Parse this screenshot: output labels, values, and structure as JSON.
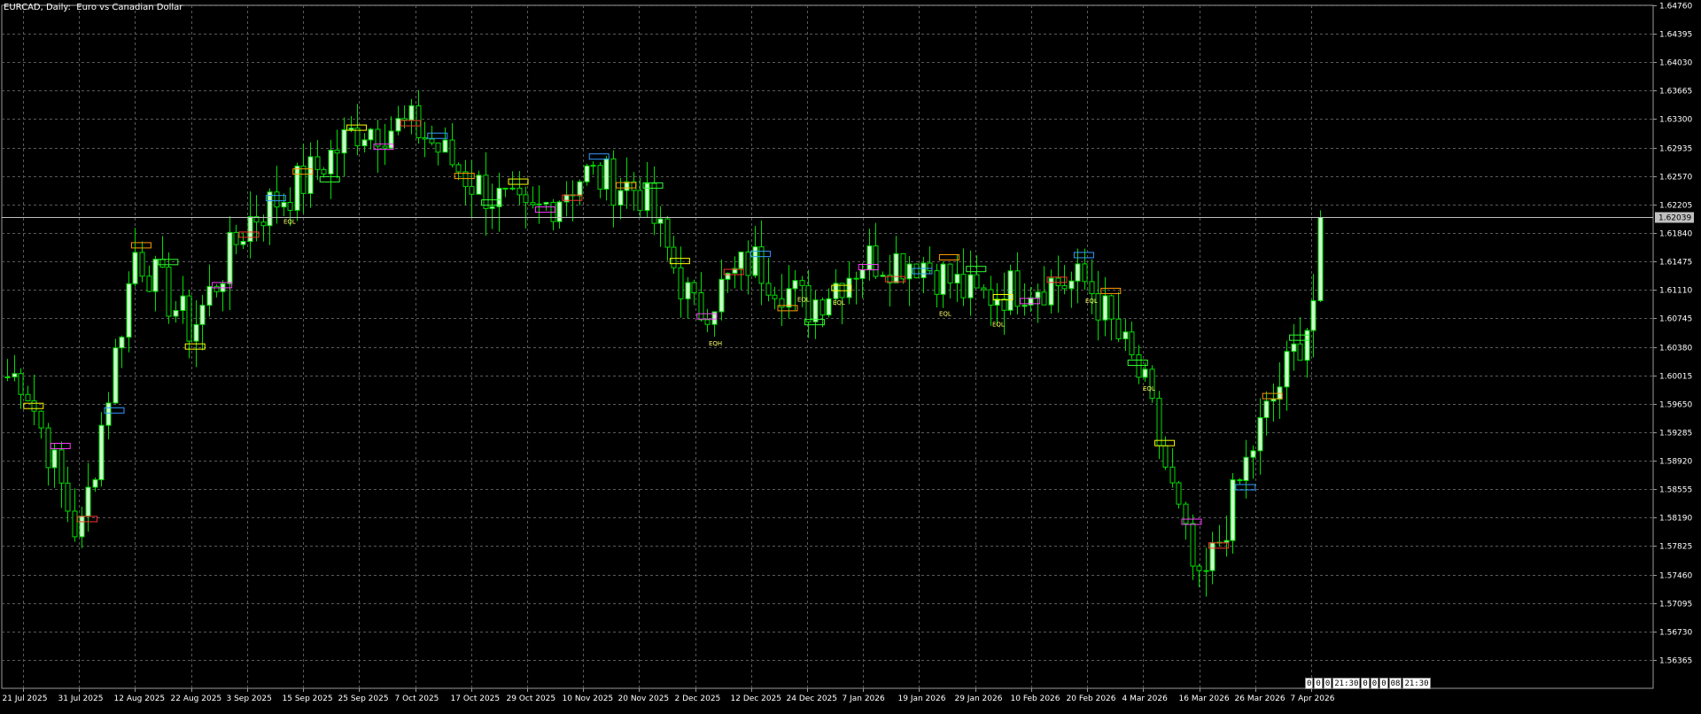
{
  "chart_data": {
    "type": "candlestick",
    "title": "EURCAD, Daily:  Euro vs Canadian Dollar",
    "symbol": "EURCAD",
    "timeframe": "Daily",
    "ylim": [
      1.56,
      1.6476
    ],
    "yticks": [
      "1.64760",
      "1.64395",
      "1.64030",
      "1.63665",
      "1.63300",
      "1.62935",
      "1.62570",
      "1.62205",
      "1.61840",
      "1.61475",
      "1.61110",
      "1.60745",
      "1.60380",
      "1.60015",
      "1.59650",
      "1.59285",
      "1.58920",
      "1.58555",
      "1.58190",
      "1.57825",
      "1.57460",
      "1.57095",
      "1.56730",
      "1.56365"
    ],
    "xticks": [
      "21 Jul 2025",
      "31 Jul 2025",
      "12 Aug 2025",
      "22 Aug 2025",
      "3 Sep 2025",
      "15 Sep 2025",
      "25 Sep 2025",
      "7 Oct 2025",
      "17 Oct 2025",
      "29 Oct 2025",
      "10 Nov 2025",
      "20 Nov 2025",
      "2 Dec 2025",
      "12 Dec 2025",
      "24 Dec 2025",
      "7 Jan 2026",
      "19 Jan 2026",
      "29 Jan 2026",
      "10 Feb 2026",
      "20 Feb 2026",
      "4 Mar 2026",
      "16 Mar 2026",
      "26 Mar 2026",
      "7 Apr 2026"
    ],
    "current_price": "1.62039",
    "current_price_value": 1.62039,
    "close_path": [
      [
        "21 Jul 2025",
        1.6
      ],
      [
        "31 Jul 2025",
        1.579
      ],
      [
        "12 Aug 2025",
        1.616
      ],
      [
        "22 Aug 2025",
        1.606
      ],
      [
        "3 Sep 2025",
        1.62
      ],
      [
        "15 Sep 2025",
        1.625
      ],
      [
        "25 Sep 2025",
        1.632
      ],
      [
        "7 Oct 2025",
        1.632
      ],
      [
        "17 Oct 2025",
        1.625
      ],
      [
        "29 Oct 2025",
        1.62
      ],
      [
        "10 Nov 2025",
        1.626
      ],
      [
        "20 Nov 2025",
        1.624
      ],
      [
        "2 Dec 2025",
        1.608
      ],
      [
        "12 Dec 2025",
        1.615
      ],
      [
        "24 Dec 2025",
        1.609
      ],
      [
        "7 Jan 2026",
        1.615
      ],
      [
        "19 Jan 2026",
        1.615
      ],
      [
        "29 Jan 2026",
        1.61
      ],
      [
        "10 Feb 2026",
        1.612
      ],
      [
        "20 Feb 2026",
        1.612
      ],
      [
        "4 Mar 2026",
        1.599
      ],
      [
        "16 Mar 2026",
        1.572
      ],
      [
        "26 Mar 2026",
        1.592
      ],
      [
        "7 Apr 2026",
        1.608
      ],
      [
        "7 Apr 2026",
        1.62
      ]
    ],
    "grid": true,
    "colors": {
      "background": "#000000",
      "grid": "#5a5a5a",
      "axis_text": "#ffffff",
      "bull_body": "#ccffcc",
      "bear_body": "#000000",
      "wick": "#00dd00",
      "price_line": "#c0c0c0",
      "price_label_bg": "#c0c0c0",
      "price_label_text": "#000000"
    },
    "annotation_labels": [
      "EQL",
      "EQH",
      "EQL",
      "EQL",
      "EQL",
      "EQL",
      "EQL",
      "EQL"
    ],
    "annotation_colors": [
      "#ffff00",
      "#ff3cff",
      "#ff3333",
      "#3399ff",
      "#ff9900",
      "#33ff33"
    ]
  },
  "timer": [
    "0",
    "0",
    "0",
    "21:30",
    "0",
    "0",
    "0",
    "08",
    "21:30"
  ]
}
